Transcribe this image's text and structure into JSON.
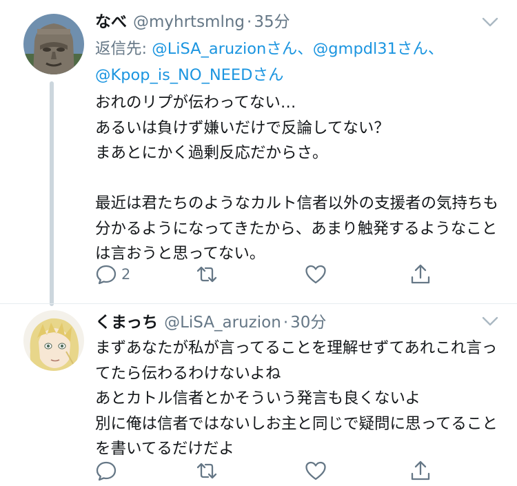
{
  "tweets": [
    {
      "name": "なべ",
      "handle": "@myhrtsmlng",
      "dot": "·",
      "time": "35分",
      "reply_prefix": "返信先: ",
      "reply_mentions": [
        "@LiSA_aruzionさん、",
        "@gmpdl31さん、",
        "@Kpop_is_NO_NEEDさん"
      ],
      "body": "おれのリプが伝わってない…\nあるいは負けず嫌いだけで反論してない？\nまあとにかく過剰反応だからさ。\n\n最近は君たちのようなカルト信者以外の支援者の気持ちも分かるようになってきたから、あまり触発するようなことは言おうと思ってない。",
      "reply_count": "2",
      "icons": [
        "reply-icon",
        "retweet-icon",
        "like-icon",
        "share-icon"
      ]
    },
    {
      "name": "くまっち",
      "handle": "@LiSA_aruzion",
      "dot": "·",
      "time": "30分",
      "body": "まずあなたが私が言ってることを理解せずてあれこれ言ってたら伝わるわけないよね\nあとカトル信者とかそういう発言も良くないよ\n別に俺は信者ではないしお主と同じで疑問に思ってることを書いてるだけだよ",
      "reply_count": "",
      "icons": [
        "reply-icon",
        "retweet-icon",
        "like-icon",
        "share-icon"
      ]
    }
  ],
  "colors": {
    "text": "#14171a",
    "secondary": "#657786",
    "link": "#1b95e0",
    "thread_line": "#ccd6dd",
    "divider": "#e6ecf0"
  }
}
